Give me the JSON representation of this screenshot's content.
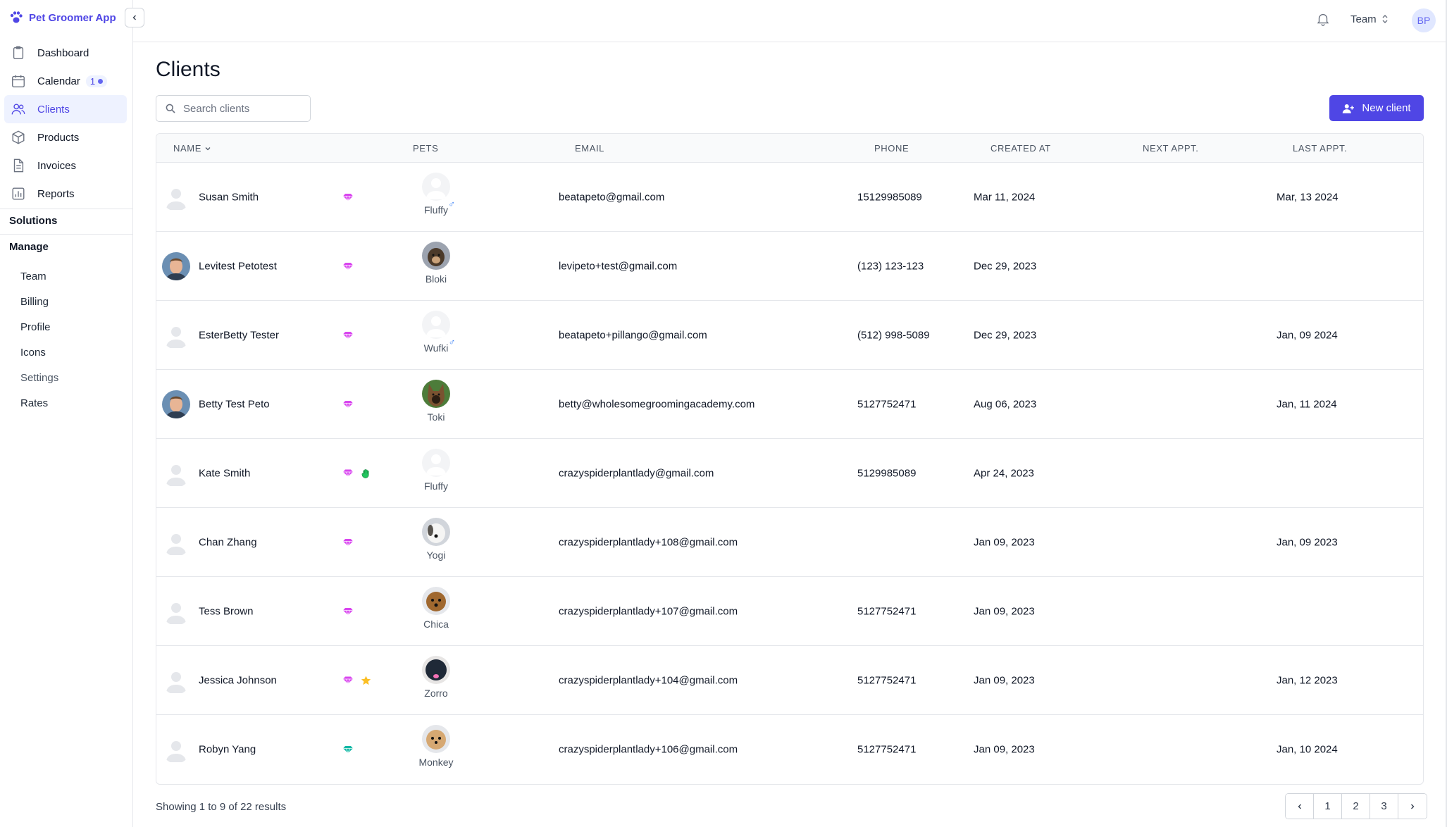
{
  "app": {
    "name": "Pet Groomer App"
  },
  "nav": [
    {
      "label": "Dashboard",
      "icon": "clipboard-icon"
    },
    {
      "label": "Calendar",
      "icon": "calendar-icon",
      "badge": "1"
    },
    {
      "label": "Clients",
      "icon": "users-icon",
      "active": true
    },
    {
      "label": "Products",
      "icon": "box-icon"
    },
    {
      "label": "Invoices",
      "icon": "document-icon"
    },
    {
      "label": "Reports",
      "icon": "chart-icon"
    }
  ],
  "sections": {
    "solutions": "Solutions",
    "manage": "Manage"
  },
  "manage_items": [
    "Team",
    "Billing",
    "Profile",
    "Icons",
    "Settings",
    "Rates"
  ],
  "topbar": {
    "team_label": "Team",
    "user_initials": "BP"
  },
  "page": {
    "title": "Clients",
    "search_placeholder": "Search clients",
    "new_client_label": "New client"
  },
  "table": {
    "headers": {
      "name": "NAME",
      "pets": "PETS",
      "email": "EMAIL",
      "phone": "PHONE",
      "created_at": "CREATED AT",
      "next_appt": "NEXT APPT.",
      "last_appt": "LAST APPT."
    },
    "rows": [
      {
        "name": "Susan Smith",
        "avatar": "default",
        "tags": [
          "gem-pink"
        ],
        "pet": "Fluffy",
        "pet_photo": "default",
        "pet_gender": "♂",
        "email": "beatapeto@gmail.com",
        "phone": "15129985089",
        "created_at": "Mar 11, 2024",
        "next_appt": "",
        "last_appt": "Mar, 13 2024"
      },
      {
        "name": "Levitest Petotest",
        "avatar": "photo-man",
        "tags": [
          "gem-pink"
        ],
        "pet": "Bloki",
        "pet_photo": "dog-dark",
        "pet_gender": "",
        "email": "levipeto+test@gmail.com",
        "phone": "(123) 123-123",
        "created_at": "Dec 29, 2023",
        "next_appt": "",
        "last_appt": ""
      },
      {
        "name": "EsterBetty Tester",
        "avatar": "default",
        "tags": [
          "gem-pink"
        ],
        "pet": "Wufki",
        "pet_photo": "default",
        "pet_gender": "♂",
        "email": "beatapeto+pillango@gmail.com",
        "phone": "(512) 998-5089",
        "created_at": "Dec 29, 2023",
        "next_appt": "",
        "last_appt": "Jan, 09 2024"
      },
      {
        "name": "Betty Test Peto",
        "avatar": "photo-man",
        "tags": [
          "gem-pink"
        ],
        "pet": "Toki",
        "pet_photo": "dog-shepherd",
        "pet_gender": "",
        "email": "betty@wholesomegroomingacademy.com",
        "phone": "5127752471",
        "created_at": "Aug 06, 2023",
        "next_appt": "",
        "last_appt": "Jan, 11 2024"
      },
      {
        "name": "Kate Smith",
        "avatar": "default",
        "tags": [
          "gem-pink",
          "hand-green"
        ],
        "pet": "Fluffy",
        "pet_photo": "default",
        "pet_gender": "",
        "email": "crazyspiderplantlady@gmail.com",
        "phone": "5129985089",
        "created_at": "Apr 24, 2023",
        "next_appt": "",
        "last_appt": ""
      },
      {
        "name": "Chan Zhang",
        "avatar": "default",
        "tags": [
          "gem-pink"
        ],
        "pet": "Yogi",
        "pet_photo": "dog-white",
        "pet_gender": "",
        "email": "crazyspiderplantlady+108@gmail.com",
        "phone": "",
        "created_at": "Jan 09, 2023",
        "next_appt": "",
        "last_appt": "Jan, 09 2023"
      },
      {
        "name": "Tess Brown",
        "avatar": "default",
        "tags": [
          "gem-pink"
        ],
        "pet": "Chica",
        "pet_photo": "dog-brown",
        "pet_gender": "",
        "email": "crazyspiderplantlady+107@gmail.com",
        "phone": "5127752471",
        "created_at": "Jan 09, 2023",
        "next_appt": "",
        "last_appt": ""
      },
      {
        "name": "Jessica Johnson",
        "avatar": "default",
        "tags": [
          "gem-pink",
          "star-yellow"
        ],
        "pet": "Zorro",
        "pet_photo": "dog-black",
        "pet_gender": "",
        "email": "crazyspiderplantlady+104@gmail.com",
        "phone": "5127752471",
        "created_at": "Jan 09, 2023",
        "next_appt": "",
        "last_appt": "Jan, 12 2023"
      },
      {
        "name": "Robyn Yang",
        "avatar": "default",
        "tags": [
          "gem-teal"
        ],
        "pet": "Monkey",
        "pet_photo": "dog-tan",
        "pet_gender": "",
        "email": "crazyspiderplantlady+106@gmail.com",
        "phone": "5127752471",
        "created_at": "Jan 09, 2023",
        "next_appt": "",
        "last_appt": "Jan, 10 2024"
      }
    ]
  },
  "footer": {
    "summary": "Showing 1 to 9 of 22 results",
    "pages": [
      "1",
      "2",
      "3"
    ]
  },
  "colors": {
    "accent": "#4f46e5",
    "gem_pink": "#d946ef",
    "gem_teal": "#14b8a6",
    "star": "#fbbf24",
    "hand": "#22c55e"
  }
}
